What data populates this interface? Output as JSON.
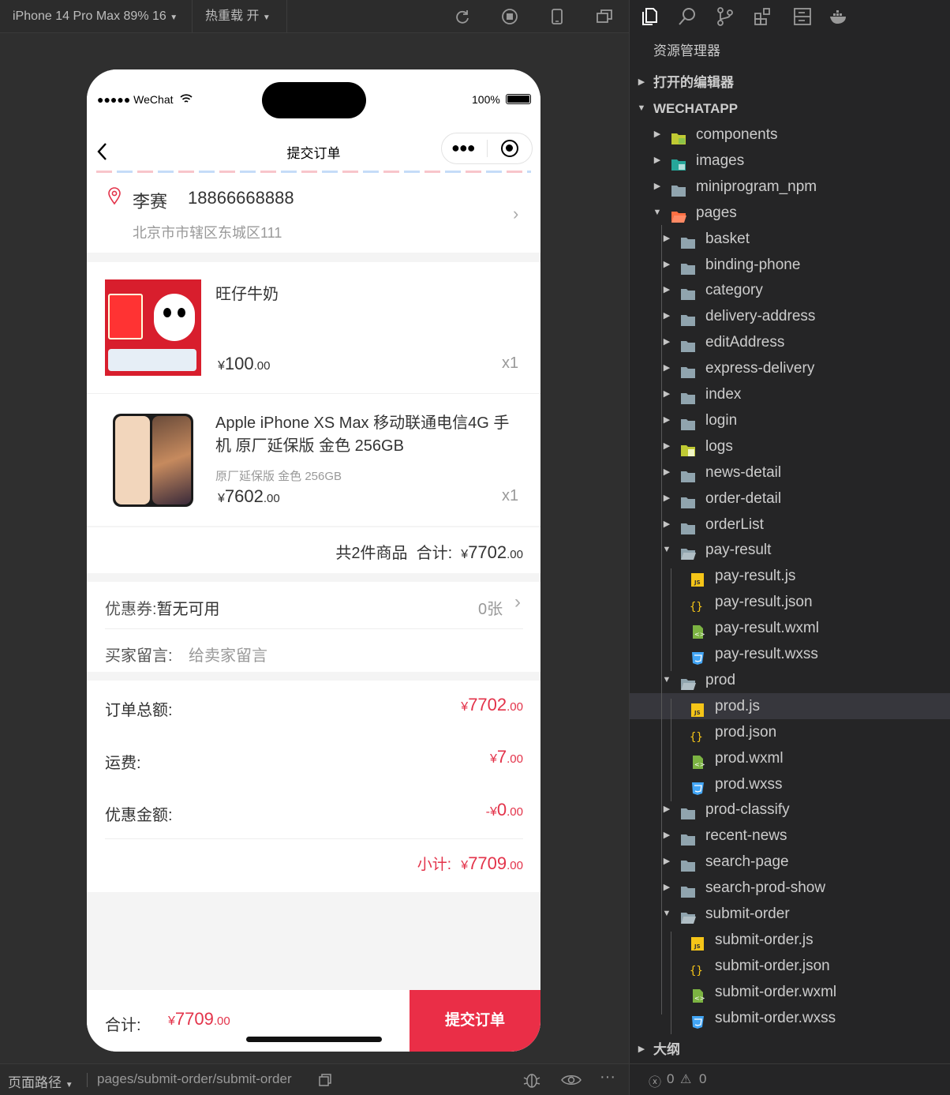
{
  "topbar": {
    "device": "iPhone 14 Pro Max 89% 16",
    "hot_reload": "热重载 开"
  },
  "phone": {
    "status": {
      "carrier": "●●●●● WeChat",
      "battery": "100%"
    },
    "nav_title": "提交订单",
    "address": {
      "name": "李赛",
      "phone": "18866668888",
      "detail": "北京市市辖区东城区111"
    },
    "items": [
      {
        "title": "旺仔牛奶",
        "spec": "",
        "price_int": "100",
        "price_dec": ".00",
        "qty": "x1"
      },
      {
        "title": "Apple iPhone XS Max 移动联通电信4G 手机 原厂延保版 金色 256GB",
        "spec": "原厂延保版 金色 256GB",
        "price_int": "7602",
        "price_dec": ".00",
        "qty": "x1"
      }
    ],
    "summary": {
      "count": "共2件商品",
      "total_label": "合计:",
      "int": "7702",
      "dec": ".00"
    },
    "currency": "¥",
    "coupon": {
      "label": "优惠券:",
      "value": "暂无可用",
      "count": "0张"
    },
    "message": {
      "label": "买家留言:",
      "placeholder": "给卖家留言"
    },
    "amounts": {
      "order_total_label": "订单总额:",
      "order_total_int": "7702",
      "order_total_dec": ".00",
      "shipping_label": "运费:",
      "shipping_int": "7",
      "shipping_dec": ".00",
      "discount_label": "优惠金额:",
      "discount_prefix": "-",
      "discount_int": "0",
      "discount_dec": ".00",
      "subtotal_label": "小计:",
      "subtotal_int": "7709",
      "subtotal_dec": ".00"
    },
    "bottom": {
      "label": "合计:",
      "int": "7709",
      "dec": ".00",
      "submit": "提交订单"
    }
  },
  "statusbar": {
    "path_label": "页面路径",
    "path": "pages/submit-order/submit-order"
  },
  "explorer": {
    "title": "资源管理器",
    "open_editors": "打开的编辑器",
    "project": "WECHATAPP",
    "outline": "大纲",
    "errors": "0",
    "warnings": "0",
    "tree": [
      {
        "label": "components",
        "depth": 1,
        "kind": "folder-components",
        "twisty": "▶"
      },
      {
        "label": "images",
        "depth": 1,
        "kind": "folder-images",
        "twisty": "▶"
      },
      {
        "label": "miniprogram_npm",
        "depth": 1,
        "kind": "folder",
        "twisty": "▶"
      },
      {
        "label": "pages",
        "depth": 1,
        "kind": "folder-pages",
        "twisty": "▼"
      },
      {
        "label": "basket",
        "depth": 2,
        "kind": "folder",
        "twisty": "▶"
      },
      {
        "label": "binding-phone",
        "depth": 2,
        "kind": "folder",
        "twisty": "▶"
      },
      {
        "label": "category",
        "depth": 2,
        "kind": "folder",
        "twisty": "▶"
      },
      {
        "label": "delivery-address",
        "depth": 2,
        "kind": "folder",
        "twisty": "▶"
      },
      {
        "label": "editAddress",
        "depth": 2,
        "kind": "folder",
        "twisty": "▶"
      },
      {
        "label": "express-delivery",
        "depth": 2,
        "kind": "folder",
        "twisty": "▶"
      },
      {
        "label": "index",
        "depth": 2,
        "kind": "folder",
        "twisty": "▶"
      },
      {
        "label": "login",
        "depth": 2,
        "kind": "folder",
        "twisty": "▶"
      },
      {
        "label": "logs",
        "depth": 2,
        "kind": "folder-logs",
        "twisty": "▶"
      },
      {
        "label": "news-detail",
        "depth": 2,
        "kind": "folder",
        "twisty": "▶"
      },
      {
        "label": "order-detail",
        "depth": 2,
        "kind": "folder",
        "twisty": "▶"
      },
      {
        "label": "orderList",
        "depth": 2,
        "kind": "folder",
        "twisty": "▶"
      },
      {
        "label": "pay-result",
        "depth": 2,
        "kind": "folder-open",
        "twisty": "▼"
      },
      {
        "label": "pay-result.js",
        "depth": 3,
        "kind": "js",
        "twisty": ""
      },
      {
        "label": "pay-result.json",
        "depth": 3,
        "kind": "json",
        "twisty": ""
      },
      {
        "label": "pay-result.wxml",
        "depth": 3,
        "kind": "wxml",
        "twisty": ""
      },
      {
        "label": "pay-result.wxss",
        "depth": 3,
        "kind": "wxss",
        "twisty": ""
      },
      {
        "label": "prod",
        "depth": 2,
        "kind": "folder-open",
        "twisty": "▼"
      },
      {
        "label": "prod.js",
        "depth": 3,
        "kind": "js",
        "twisty": "",
        "selected": true
      },
      {
        "label": "prod.json",
        "depth": 3,
        "kind": "json",
        "twisty": ""
      },
      {
        "label": "prod.wxml",
        "depth": 3,
        "kind": "wxml",
        "twisty": ""
      },
      {
        "label": "prod.wxss",
        "depth": 3,
        "kind": "wxss",
        "twisty": ""
      },
      {
        "label": "prod-classify",
        "depth": 2,
        "kind": "folder",
        "twisty": "▶"
      },
      {
        "label": "recent-news",
        "depth": 2,
        "kind": "folder",
        "twisty": "▶"
      },
      {
        "label": "search-page",
        "depth": 2,
        "kind": "folder",
        "twisty": "▶"
      },
      {
        "label": "search-prod-show",
        "depth": 2,
        "kind": "folder",
        "twisty": "▶"
      },
      {
        "label": "submit-order",
        "depth": 2,
        "kind": "folder-open",
        "twisty": "▼"
      },
      {
        "label": "submit-order.js",
        "depth": 3,
        "kind": "js",
        "twisty": ""
      },
      {
        "label": "submit-order.json",
        "depth": 3,
        "kind": "json",
        "twisty": ""
      },
      {
        "label": "submit-order.wxml",
        "depth": 3,
        "kind": "wxml",
        "twisty": ""
      },
      {
        "label": "submit-order.wxss",
        "depth": 3,
        "kind": "wxss",
        "twisty": ""
      }
    ]
  }
}
